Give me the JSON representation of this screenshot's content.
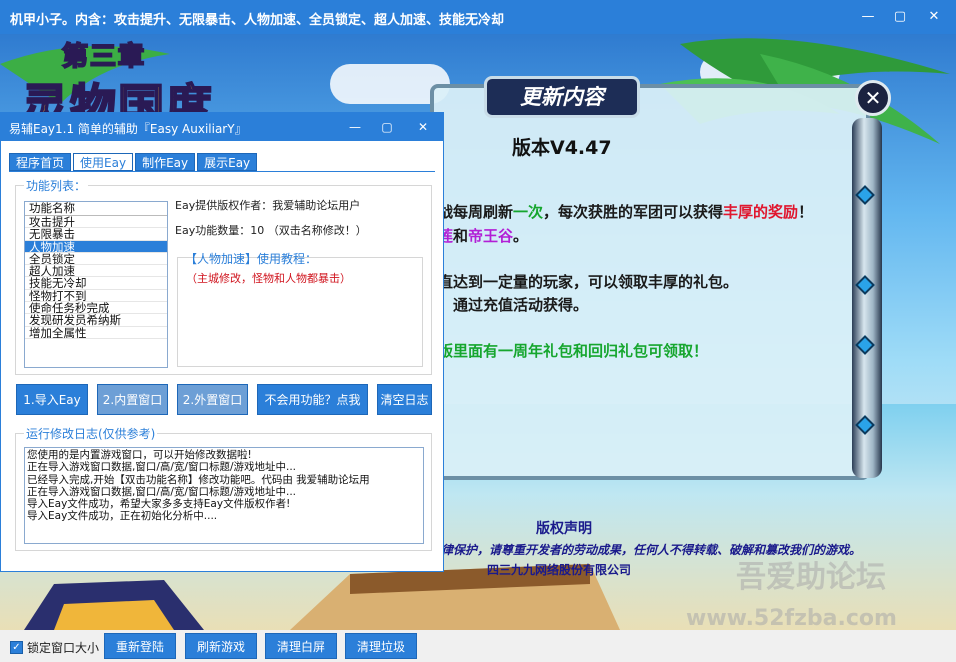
{
  "outer_window": {
    "title": "机甲小子。内含：攻击提升、无限暴击、人物加速、全员锁定、超人加速、技能无冷却",
    "controls": {
      "minimize": "—",
      "maximize": "▢",
      "close": "✕"
    }
  },
  "game": {
    "chapter_text": "第三章",
    "logo_text": "灵物国度",
    "update_panel": {
      "header": "更新内容",
      "close": "✕",
      "version": "版本V4.47",
      "lines": [
        {
          "pre": "战每周刷新",
          "hl": "一次",
          "mid": "，每次获胜的军团可以获得",
          "hl2": "丰厚的奖励",
          "post": "！"
        },
        {
          "pre": "",
          "hl": "莲",
          "mid": "和",
          "hl2": "帝王谷",
          "post": "。"
        },
        {
          "pre": "。",
          "hl": "",
          "mid": "",
          "hl2": "",
          "post": ""
        },
        {
          "pre": "直达到一定量的玩家，可以领取丰厚的礼包。",
          "hl": "",
          "mid": "",
          "hl2": "",
          "post": ""
        },
        {
          "pre": "，通过充值活动获得。",
          "hl": "",
          "mid": "",
          "hl2": "",
          "post": ""
        },
        {
          "pre": "",
          "hl": "版里面有一周年礼包和回归礼包可领取！",
          "mid": "",
          "hl2": "",
          "post": ""
        }
      ]
    },
    "copyright": {
      "title": "版权声明",
      "text": "《机甲小子》产品已经获得版权证书受法律保护，请尊重开发者的劳动成果，任何人不得转载、破解和篡改我们的游戏。",
      "company": "四三九九网络股份有限公司"
    },
    "watermark_1": "吾爱助论坛",
    "watermark_2": "www.52fzba.com"
  },
  "inner_window": {
    "title": "易辅Eay1.1    简单的辅助『Easy AuxiliarY』",
    "controls": {
      "minimize": "—",
      "maximize": "▢",
      "close": "✕"
    },
    "tabs": [
      {
        "label": "程序首页",
        "active": false
      },
      {
        "label": "使用Eay",
        "active": true
      },
      {
        "label": "制作Eay",
        "active": false
      },
      {
        "label": "展示Eay",
        "active": false
      }
    ],
    "function_list_label": "功能列表：",
    "function_list": {
      "header": "功能名称",
      "items": [
        "攻击提升",
        "无限暴击",
        "人物加速",
        "全员锁定",
        "超人加速",
        "技能无冷却",
        "怪物打不到",
        "使命任务秒完成",
        "发现研发员希纳斯",
        "增加全属性"
      ],
      "selected_index": 2
    },
    "author_line": "Eay提供版权作者：我爱辅助论坛用户",
    "count_line": "Eay功能数量：10  （双击名称修改！）",
    "tutorial_title": "【人物加速】使用教程：",
    "tutorial_text": "（主城修改，怪物和人物都暴击）",
    "buttons": {
      "import": "1.导入Eay",
      "inner_window": "2.内置窗口",
      "outer_window": "2.外置窗口",
      "help": "不会用功能？点我",
      "clear_log": "清空日志"
    },
    "log_label": "运行修改日志(仅供参考)",
    "log_lines": [
      "您使用的是内置游戏窗口，可以开始修改数据啦!",
      "正在导入游戏窗口数据,窗口/高/宽/窗口标题/游戏地址中...",
      "已经导入完成,开始【双击功能名称】修改功能吧。代码由 我爱辅助论坛用",
      "正在导入游戏窗口数据,窗口/高/宽/窗口标题/游戏地址中...",
      "导入Eay文件成功，希望大家多多支持Eay文件版权作者!",
      "导入Eay文件成功，正在初始化分析中...."
    ]
  },
  "bottom_bar": {
    "lock_label": "锁定窗口大小",
    "lock_checked": true,
    "buttons": [
      "重新登陆",
      "刷新游戏",
      "清理白屏",
      "清理垃圾"
    ]
  }
}
